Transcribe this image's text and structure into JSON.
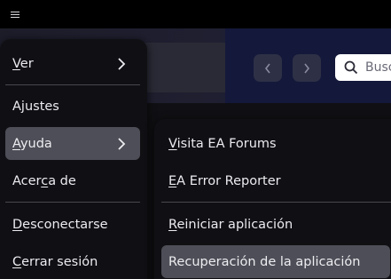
{
  "titlebar": {
    "menu_icon": "hamburger-icon"
  },
  "header": {
    "back_icon": "chevron-left-icon",
    "forward_icon": "chevron-right-icon",
    "search_icon": "search-icon",
    "search_text": "Busc"
  },
  "menu": {
    "items": [
      {
        "mnemonic": "V",
        "rest": "er",
        "has_submenu": true
      },
      {
        "mnemonic": "",
        "rest": "Ajustes",
        "has_submenu": false
      },
      {
        "mnemonic": "A",
        "rest": "yuda",
        "has_submenu": true,
        "active": true
      },
      {
        "pre": "Acer",
        "mnemonic": "c",
        "rest": "a de",
        "has_submenu": false
      },
      {
        "mnemonic": "D",
        "rest": "esconectarse",
        "has_submenu": false
      },
      {
        "mnemonic": "C",
        "rest": "errar sesión",
        "has_submenu": false
      }
    ]
  },
  "submenu": {
    "items": [
      {
        "mnemonic": "V",
        "rest": "isita EA Forums"
      },
      {
        "mnemonic": "E",
        "rest": "A Error Reporter"
      },
      {
        "mnemonic": "R",
        "rest": "einiciar aplicación"
      },
      {
        "mnemonic": "",
        "rest": "Recuperación de la aplicación",
        "active": true
      }
    ]
  },
  "colors": {
    "menu_bg": "#101014",
    "highlight": "#4e4e58",
    "separator": "#46464e",
    "header_accent": "#14183a",
    "nav_button": "#2e3046"
  }
}
